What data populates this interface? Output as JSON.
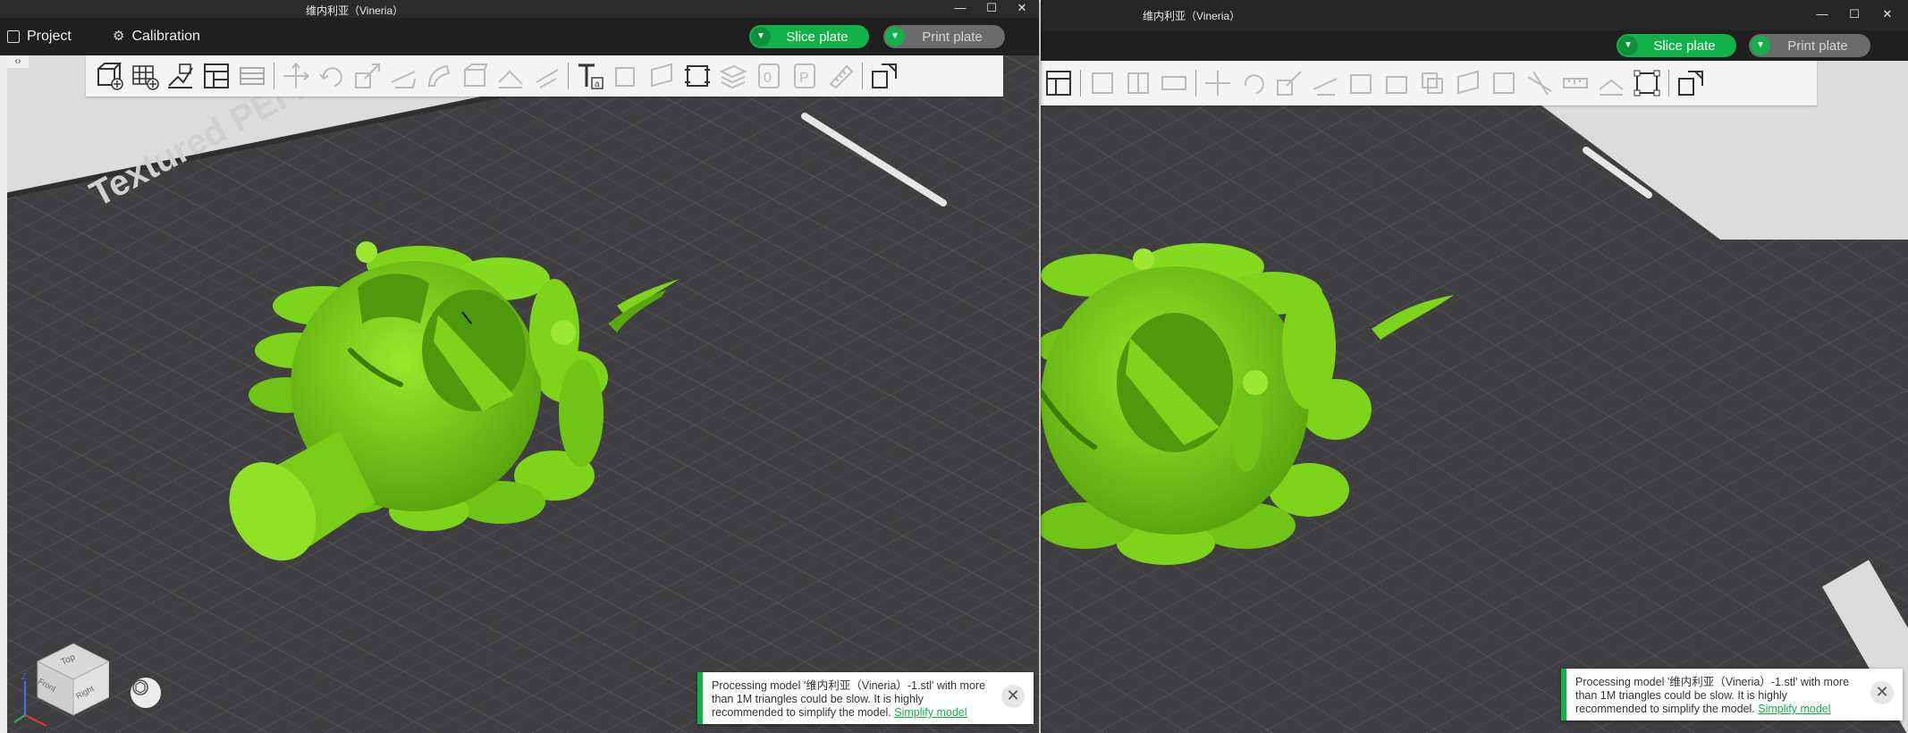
{
  "left_window": {
    "title": "维内利亚（Vineria）",
    "controls": {
      "minimize": "—",
      "maximize": "☐",
      "close": "✕"
    },
    "menu": {
      "project_label": "Project",
      "calibration_label": "Calibration"
    },
    "slice_button": "Slice plate",
    "print_button": "Print plate",
    "sidebar_toggle": "‹›",
    "bed_text": "Textured PEI Plate",
    "notification": {
      "message": "Processing model '维内利亚（Vineria）-1.stl' with more than 1M triangles could be slow. It is highly recommended to simplify the model.",
      "link": "Simplify model"
    },
    "viewcube": {
      "top": "Top",
      "front": "Front",
      "right": "Right",
      "axis_z": "Z"
    }
  },
  "right_window": {
    "title": "维内利亚（Vineria）",
    "controls": {
      "minimize": "—",
      "maximize": "☐",
      "close": "✕"
    },
    "slice_button": "Slice plate",
    "print_button": "Print plate",
    "notification": {
      "message": "Processing model '维内利亚（Vineria）-1.stl' with more than 1M triangles could be slow. It is highly recommended to simplify the model.",
      "link": "Simplify model"
    }
  },
  "icons": {
    "left_toolbar": [
      "add-cube-icon",
      "add-plate-grid-icon",
      "auto-orient-icon",
      "arrange-layout-icon",
      "split-parts-icon",
      "move-icon",
      "rotate-icon",
      "scale-icon",
      "cut-icon",
      "support-paint-icon",
      "seam-paint-icon",
      "measure-icon",
      "mesh-boolean-icon",
      "text-tool-icon",
      "assembly-icon",
      "emboss-icon",
      "layer-height-icon",
      "variable-layer-icon",
      "object-list-icon",
      "zero-icon",
      "parts-icon",
      "ruler-icon",
      "multi-view-icon"
    ],
    "right_toolbar": [
      "arrange-layout-icon",
      "split-parts-icon",
      "split-objects-icon",
      "lay-on-face-icon",
      "move-icon",
      "rotate-icon",
      "scale-icon",
      "cut-icon",
      "support-paint-icon",
      "seam-paint-icon",
      "mesh-boolean-icon",
      "color-paint-icon",
      "fuzzy-icon",
      "variable-layer-icon",
      "ruler-icon",
      "assembly-icon",
      "bounding-box-icon",
      "multi-view-icon"
    ]
  },
  "colors": {
    "accent_green": "#12b14a",
    "model_green": "#7ed41a",
    "bed": "#3f3f41",
    "titlebar": "#2b2b2b"
  }
}
